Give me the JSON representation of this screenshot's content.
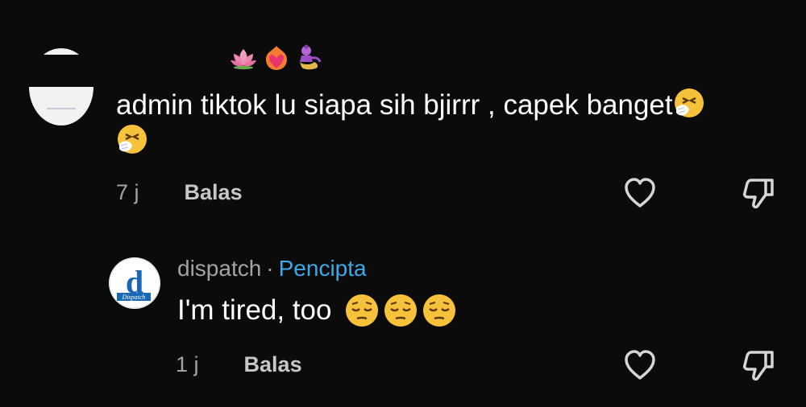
{
  "comments": [
    {
      "text": "admin tiktok lu siapa sih bjirrr , capek banget",
      "time": "7 j",
      "reply_label": "Balas"
    },
    {
      "author": "dispatch",
      "separator": "·",
      "role": "Pencipta",
      "text": "I'm tired, too",
      "time": "1 j",
      "reply_label": "Balas",
      "avatar_logo_text": "Dispatch"
    }
  ],
  "colors": {
    "background": "#0b0b0b",
    "creator_badge": "#3da9e6",
    "avatar_brand": "#1a67b5"
  },
  "icons": [
    "like-heart-icon",
    "dislike-thumb-icon",
    "lotus-emoji",
    "heart-emoji",
    "genie-emoji",
    "sneezing-face-emoji",
    "pensive-face-emoji"
  ]
}
